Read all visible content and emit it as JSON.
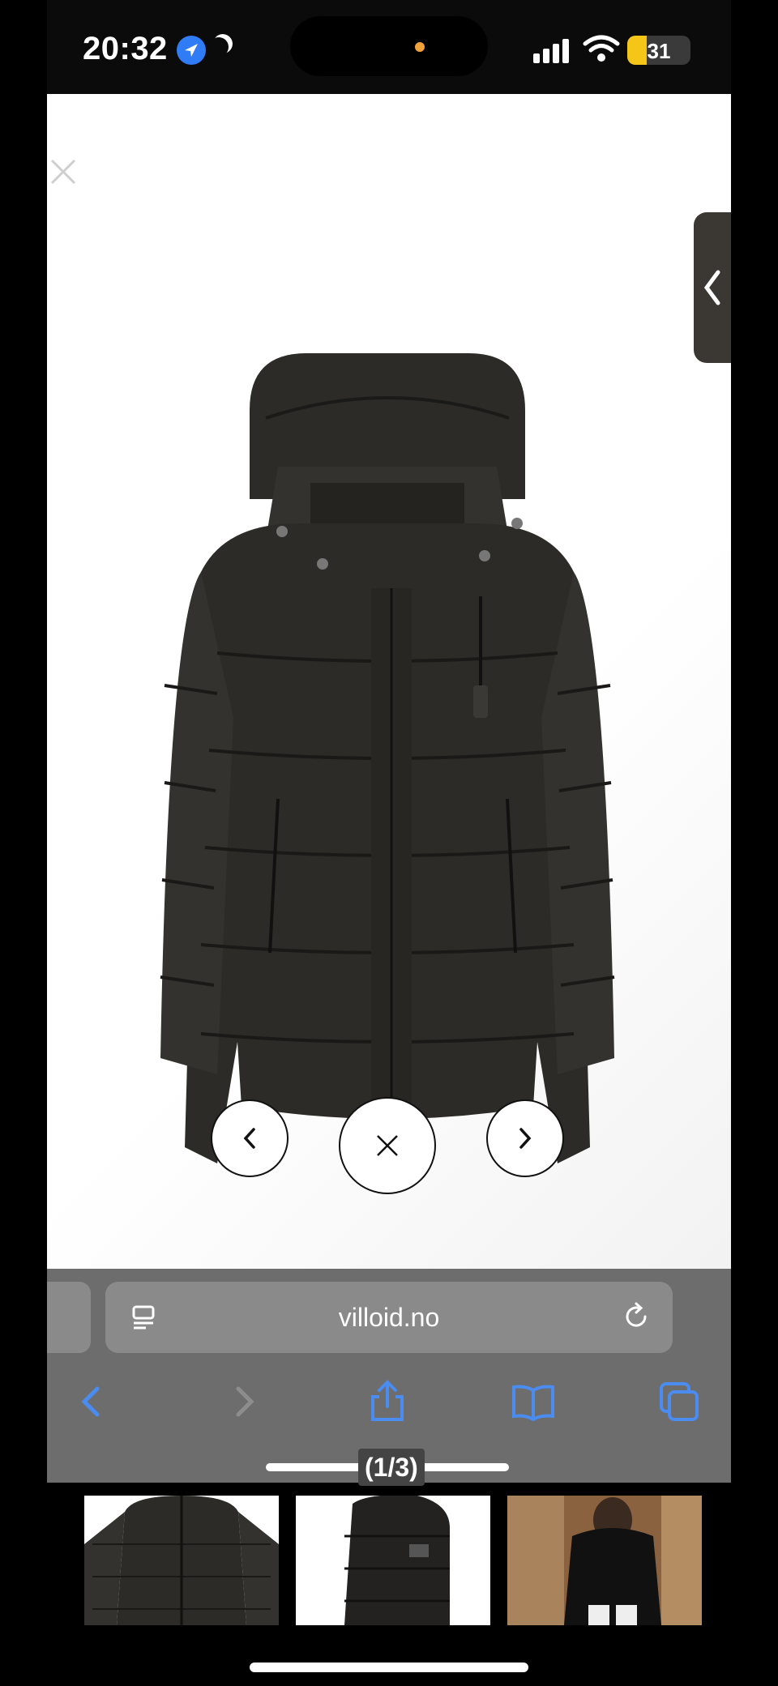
{
  "status_bar": {
    "time": "20:32",
    "battery": "31",
    "icons": [
      "location-arrow-icon",
      "moon-icon",
      "signal-icon",
      "wifi-icon",
      "battery-icon"
    ]
  },
  "product": {
    "image_alt": "Black hooded puffer jacket",
    "gallery_counter": "(1/3)"
  },
  "browser": {
    "url": "villoid.no"
  },
  "thumbnails": [
    {
      "name": "front"
    },
    {
      "name": "side"
    },
    {
      "name": "worn"
    }
  ],
  "colors": {
    "jacket": "#2c2b28",
    "browser_bar": "#6d6d6d",
    "url_pill": "#8a8a8a",
    "accent_blue": "#2f7cf6",
    "toolbar_blue": "#4a8cf0"
  }
}
